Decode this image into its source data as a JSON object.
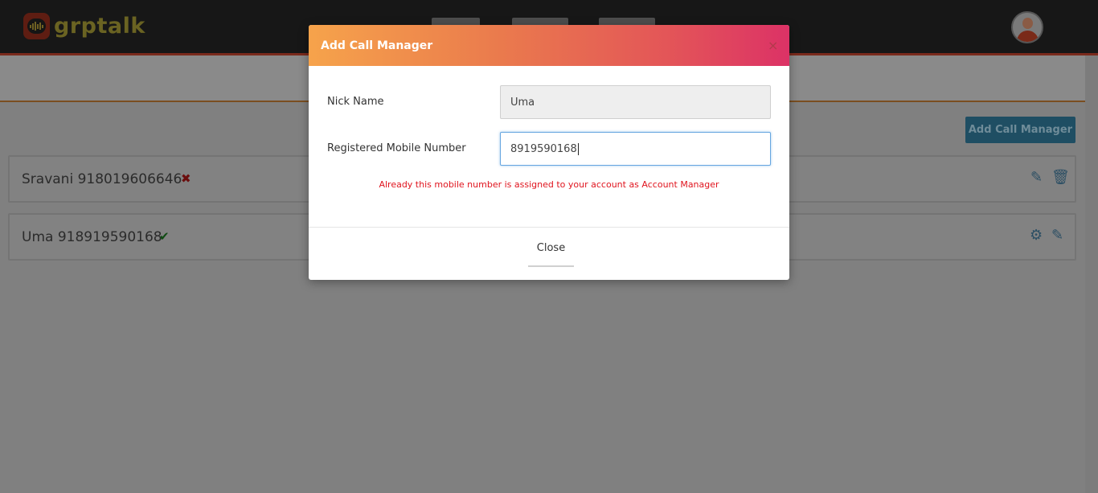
{
  "app": {
    "name": "grptalk"
  },
  "page": {
    "add_button_label": "Add Call Manager"
  },
  "managers": [
    {
      "label": "Sravani 918019606646",
      "status": "rejected",
      "status_glyph": "✖",
      "status_color": "#6b0d0d"
    },
    {
      "label": "Uma 918919590168",
      "status": "approved",
      "status_glyph": "✔",
      "status_color": "#0f4a12"
    }
  ],
  "modal": {
    "title": "Add Call Manager",
    "close_glyph": "×",
    "fields": {
      "nick_name": {
        "label": "Nick Name",
        "value": "Uma"
      },
      "mobile": {
        "label": "Registered Mobile Number",
        "value": "8919590168"
      }
    },
    "error": "Already this mobile number is assigned to your account as Account Manager",
    "close_label": "Close"
  },
  "colors": {
    "header_gradient_start": "#f6a34b",
    "header_gradient_end": "#dc3266",
    "error": "#e0141e",
    "primary_button": "#2d7fa6"
  }
}
